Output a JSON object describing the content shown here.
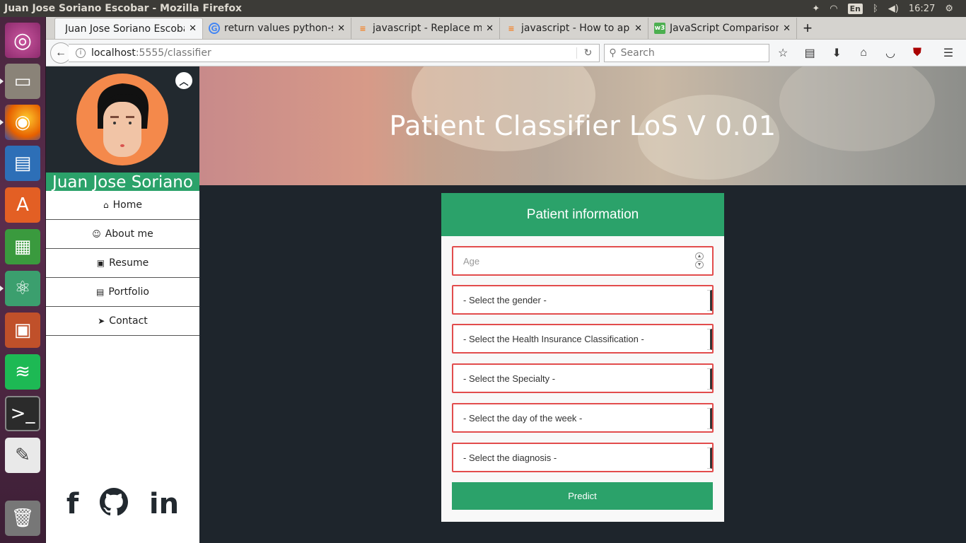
{
  "system": {
    "window_title": "Juan Jose Soriano Escobar - Mozilla Firefox",
    "language": "En",
    "clock": "16:27"
  },
  "browser": {
    "tabs": [
      {
        "label": "Juan Jose Soriano Escobar",
        "active": true
      },
      {
        "label": "return values python-s",
        "icon": "google-icon"
      },
      {
        "label": "javascript - Replace mu",
        "icon": "stackoverflow-icon"
      },
      {
        "label": "javascript - How to app",
        "icon": "stackoverflow-icon"
      },
      {
        "label": "JavaScript Comparison",
        "icon": "w3schools-icon"
      }
    ],
    "url_host": "localhost",
    "url_path": ":5555/classifier",
    "search_placeholder": "Search"
  },
  "sidebar": {
    "name": "Juan Jose Soriano",
    "nav": [
      {
        "label": "Home",
        "icon": "home-icon",
        "glyph": "⌂"
      },
      {
        "label": "About me",
        "icon": "user-circle-icon",
        "glyph": "☺"
      },
      {
        "label": "Resume",
        "icon": "id-badge-icon",
        "glyph": "▣"
      },
      {
        "label": "Portfolio",
        "icon": "briefcase-icon",
        "glyph": "▤"
      },
      {
        "label": "Contact",
        "icon": "paper-plane-icon",
        "glyph": "➤"
      }
    ],
    "social": [
      "facebook-icon",
      "github-icon",
      "linkedin-icon"
    ]
  },
  "hero": {
    "title": "Patient Classifier LoS V 0.01"
  },
  "form": {
    "heading": "Patient information",
    "age_placeholder": "Age",
    "gender": "- Select the gender -",
    "insurance": "- Select the Health Insurance Classification -",
    "specialty": "- Select the Specialty -",
    "weekday": "- Select the day of the week -",
    "diagnosis": "- Select the diagnosis -",
    "submit_label": "Predict"
  },
  "colors": {
    "accent": "#2ba26a",
    "invalid_border": "#e24c4c",
    "page_bg": "#1e252c"
  }
}
